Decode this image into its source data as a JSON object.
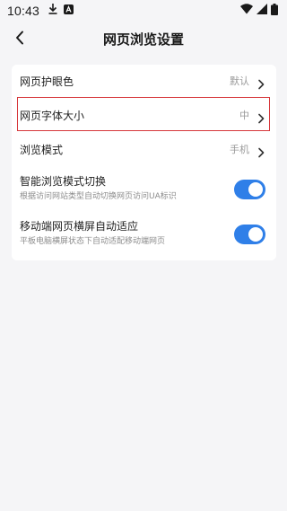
{
  "status_bar": {
    "time": "10:43",
    "left_icons": [
      "download-icon",
      "app-notification-icon"
    ],
    "right_icons": [
      "wifi-icon",
      "signal-icon",
      "battery-icon"
    ]
  },
  "header": {
    "back_icon": "chevron-left-icon",
    "title": "网页浏览设置"
  },
  "settings": {
    "eye_protection": {
      "label": "网页护眼色",
      "value": "默认"
    },
    "font_size": {
      "label": "网页字体大小",
      "value": "中"
    },
    "browse_mode": {
      "label": "浏览模式",
      "value": "手机"
    },
    "smart_mode_switch": {
      "label": "智能浏览模式切换",
      "description": "根据访问网站类型自动切换网页访问UA标识",
      "enabled": true
    },
    "auto_adapt": {
      "label": "移动端网页横屏自动适应",
      "description": "平板电脑横屏状态下自动适配移动端网页",
      "enabled": true
    }
  },
  "colors": {
    "accent": "#2f7fe8",
    "highlight_border": "#d6373b",
    "background": "#f5f5f7",
    "card": "#ffffff"
  }
}
